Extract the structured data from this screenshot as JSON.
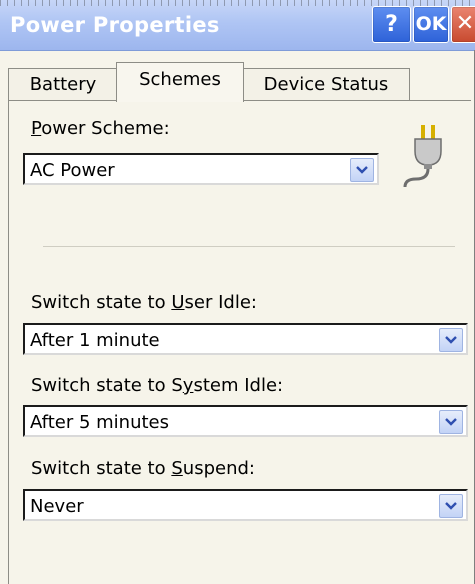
{
  "window": {
    "title": "Power Properties"
  },
  "titlebar_buttons": {
    "help": "?",
    "ok": "OK",
    "close": "✕"
  },
  "tabs": [
    {
      "label": "Battery",
      "active": false
    },
    {
      "label": "Schemes",
      "active": true
    },
    {
      "label": "Device Status",
      "active": false
    }
  ],
  "power_scheme": {
    "label_prefix": "P",
    "label_rest": "ower Scheme:",
    "value": "AC Power"
  },
  "user_idle": {
    "label_before": "Switch state to ",
    "label_u": "U",
    "label_after": "ser Idle:",
    "value": "After 1 minute"
  },
  "system_idle": {
    "label_before": "Switch state to S",
    "label_u": "y",
    "label_after": "stem Idle:",
    "value": "After 5 minutes"
  },
  "suspend": {
    "label_before": "Switch state to ",
    "label_u": "S",
    "label_after": "uspend:",
    "value": "Never"
  },
  "icons": {
    "plug": "power-plug-icon",
    "dropdown": "chevron-down-icon"
  },
  "colors": {
    "titlebar": "#afc5f4",
    "button_blue": "#2e62d8",
    "close_red": "#c84a2f",
    "background": "#f6f4ea"
  }
}
